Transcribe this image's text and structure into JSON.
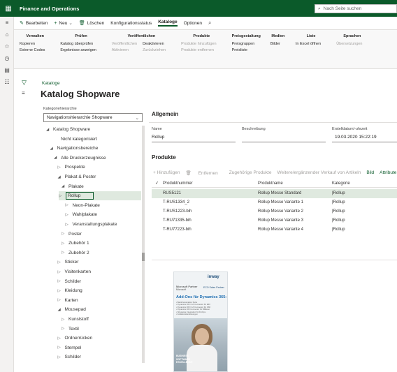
{
  "app": {
    "title": "Finance and Operations",
    "search_placeholder": "Nach Seite suchen"
  },
  "action_pane": {
    "edit": "Bearbeiten",
    "new": "Neu",
    "delete": "Löschen",
    "tabs": [
      "Konfigurationsstatus",
      "Kataloge",
      "Optionen"
    ],
    "active_tab": "Kataloge"
  },
  "ribbon": {
    "groups": [
      {
        "title": "Verwalten",
        "cols": [
          [
            {
              "t": "Kopieren",
              "d": false
            },
            {
              "t": "Externe Codes",
              "d": false
            }
          ]
        ]
      },
      {
        "title": "Prüfen",
        "cols": [
          [
            {
              "t": "Katalog überprüfen",
              "d": false
            },
            {
              "t": "Ergebnisse anzeigen",
              "d": false
            }
          ]
        ]
      },
      {
        "title": "Veröffentlichen",
        "cols": [
          [
            {
              "t": "Veröffentlichen",
              "d": true
            },
            {
              "t": "Aktivieren",
              "d": true
            }
          ],
          [
            {
              "t": "Deaktivieren",
              "d": false
            },
            {
              "t": "Zurückziehen",
              "d": true
            }
          ]
        ]
      },
      {
        "title": "Produkte",
        "cols": [
          [
            {
              "t": "Produkte hinzufügen",
              "d": true
            },
            {
              "t": "Produkte entfernen",
              "d": true
            }
          ]
        ]
      },
      {
        "title": "Preisgestaltung",
        "cols": [
          [
            {
              "t": "Preisgruppen",
              "d": false
            },
            {
              "t": "Preisliste",
              "d": false
            }
          ]
        ]
      },
      {
        "title": "Medien",
        "cols": [
          [
            {
              "t": "Bilder",
              "d": false
            }
          ]
        ]
      },
      {
        "title": "Liste",
        "cols": [
          [
            {
              "t": "In Excel öffnen",
              "d": false
            }
          ]
        ]
      },
      {
        "title": "Sprachen",
        "cols": [
          [
            {
              "t": "Übersetzungen",
              "d": true
            }
          ]
        ]
      }
    ]
  },
  "page": {
    "breadcrumb": "Kataloge",
    "title": "Katalog Shopware"
  },
  "hierarchy": {
    "label": "Kategoriehierarchie",
    "value": "Navigationshierarchie Shopware"
  },
  "tree": [
    {
      "label": "Katalog Shopware",
      "level": 0,
      "tw": "open"
    },
    {
      "label": "Nicht kategorisiert",
      "level": 2,
      "tw": "none"
    },
    {
      "label": "Navigationsbereiche",
      "level": 1,
      "tw": "open"
    },
    {
      "label": "Alle Druckerzeugnisse",
      "level": 2,
      "tw": "open"
    },
    {
      "label": "Prospekte",
      "level": 3,
      "tw": "closed"
    },
    {
      "label": "Plakat & Poster",
      "level": 3,
      "tw": "open"
    },
    {
      "label": "Plakate",
      "level": 4,
      "tw": "open"
    },
    {
      "label": "Rollup",
      "level": 5,
      "tw": "closed",
      "selected": true
    },
    {
      "label": "Neon-Plakate",
      "level": 5,
      "tw": "closed"
    },
    {
      "label": "Wahlplakate",
      "level": 5,
      "tw": "closed"
    },
    {
      "label": "Veranstaltungsplakate",
      "level": 5,
      "tw": "closed"
    },
    {
      "label": "Poster",
      "level": 4,
      "tw": "closed"
    },
    {
      "label": "Zubehör 1",
      "level": 4,
      "tw": "closed"
    },
    {
      "label": "Zubehör 2",
      "level": 4,
      "tw": "closed"
    },
    {
      "label": "Sticker",
      "level": 3,
      "tw": "closed"
    },
    {
      "label": "Visitenkarten",
      "level": 3,
      "tw": "closed"
    },
    {
      "label": "Schilder",
      "level": 3,
      "tw": "closed"
    },
    {
      "label": "Kleidung",
      "level": 3,
      "tw": "closed"
    },
    {
      "label": "Karten",
      "level": 3,
      "tw": "closed"
    },
    {
      "label": "Mousepad",
      "level": 3,
      "tw": "open"
    },
    {
      "label": "Kunststoff",
      "level": 4,
      "tw": "closed"
    },
    {
      "label": "Textil",
      "level": 4,
      "tw": "closed"
    },
    {
      "label": "Ordnerrücken",
      "level": 3,
      "tw": "closed"
    },
    {
      "label": "Stempel",
      "level": 3,
      "tw": "closed"
    },
    {
      "label": "Schilder",
      "level": 3,
      "tw": "closed"
    }
  ],
  "general": {
    "title": "Allgemein",
    "name_label": "Name",
    "name_value": "Rollup",
    "desc_label": "Beschreibung",
    "created_label": "Erstelldatum/-uhrzeit",
    "created_value": "19.03.2020 15:22:19"
  },
  "products": {
    "title": "Produkte",
    "toolbar": [
      "+ Hinzufügen",
      "Entfernen",
      "Zugehörige Produkte",
      "Weitere/ergänzender Verkauf von Artikeln",
      "Bild",
      "Attribute"
    ],
    "columns": [
      "Produktnummer",
      "Produktname",
      "Kategorie"
    ],
    "rows": [
      [
        "RUS5121",
        "Rollup Messe Standard",
        "|Rollup"
      ],
      [
        "T-RUS1334_2",
        "Rollup Messe Variante 1",
        "|Rollup"
      ],
      [
        "T-RUS1223-bih",
        "Rollup Messe Variante 2",
        "|Rollup"
      ],
      [
        "T-RU71335-bih",
        "Rollup Messe Variante 3",
        "|Rollup"
      ],
      [
        "T-RU77223-bih",
        "Rollup Messe Variante 4",
        "|Rollup"
      ]
    ]
  },
  "flyer": {
    "brand": "inway",
    "partner_1": "Microsoft Partner",
    "partner_2": "Microsoft",
    "partner_badge": "ECO Sales Partner",
    "title": "Add-Ons für Dynamics 365:",
    "lines": [
      "• Bank Automation Suite",
      "• Dynamics 365 / AX Connector für EDI",
      "• Dynamics 365 / AX Connector für OMI",
      "• Dynamics 365 Connector für BMEcat",
      "• Shopware Integration für FinOps",
      "• Kollaborationslösungen"
    ],
    "tag": [
      "BUSINESS",
      "SOFTWARE",
      "EXCELLENCE"
    ]
  }
}
